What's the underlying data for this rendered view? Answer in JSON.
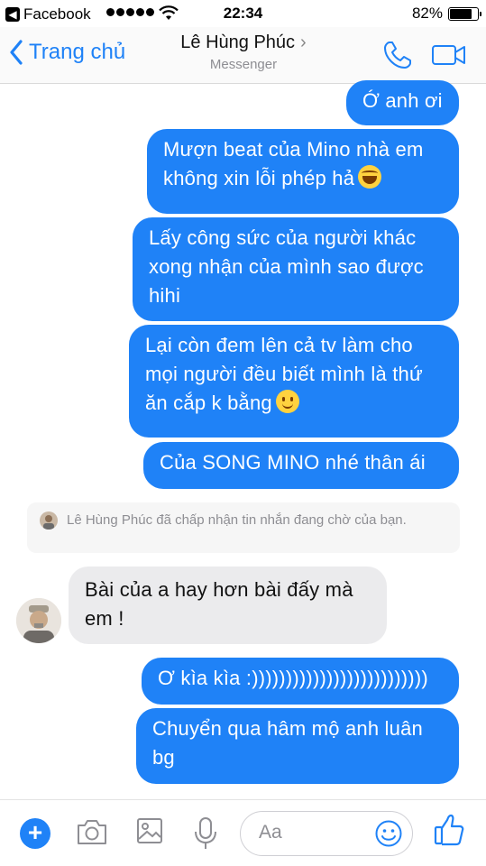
{
  "status_bar": {
    "back_app": "Facebook",
    "time": "22:34",
    "battery_pct": "82%",
    "battery_level": 0.82
  },
  "header": {
    "back_label": "Trang chủ",
    "contact_name": "Lê Hùng Phúc",
    "subtitle": "Messenger",
    "icons": [
      "chevron-left-icon",
      "chevron-right-icon",
      "phone-icon",
      "video-camera-icon"
    ]
  },
  "messages": [
    {
      "dir": "out",
      "text": "Ớ anh ơi"
    },
    {
      "dir": "out",
      "text": "Mượn beat của Mino nhà em không xin lỗi phép hả",
      "emoji": "laugh-emoji"
    },
    {
      "dir": "out",
      "text": "Lấy công sức của người khác xong nhận của mình sao được hihi"
    },
    {
      "dir": "out",
      "text": "Lại còn đem lên cả tv làm cho mọi người đều biết mình là thứ ăn cắp k bằng",
      "emoji": "smile-emoji"
    },
    {
      "dir": "out",
      "text": "Của SONG MINO nhé thân ái"
    },
    {
      "dir": "in",
      "text": "Bài của a hay hơn bài đấy mà em !"
    },
    {
      "dir": "out",
      "text": "Ơ kìa kìa :))))))))))))))))))))))))))"
    },
    {
      "dir": "out",
      "text": "Chuyển qua hâm mộ anh luân bg"
    }
  ],
  "notice": {
    "text": "Lê Hùng Phúc đã chấp nhận tin nhắn đang chờ của bạn."
  },
  "composer": {
    "placeholder": "Aa",
    "icons": [
      "plus-icon",
      "camera-icon",
      "image-icon",
      "microphone-icon",
      "emoji-icon",
      "thumbs-up-icon"
    ]
  },
  "colors": {
    "accent": "#1f82f7",
    "incoming_bubble": "#ebebed"
  }
}
